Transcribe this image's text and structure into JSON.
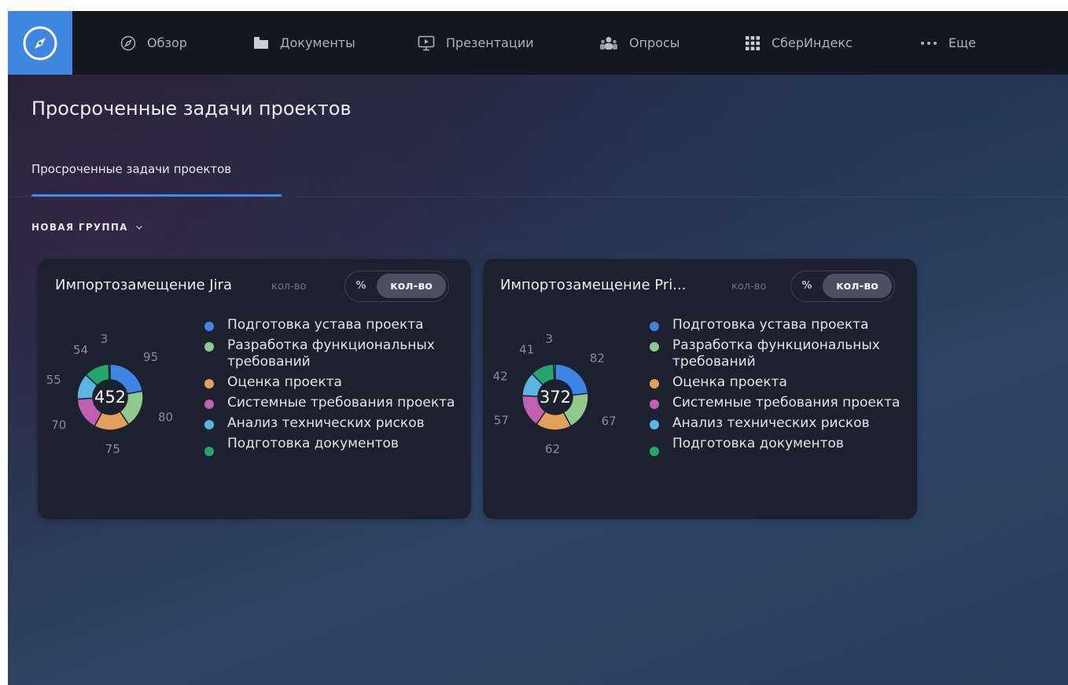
{
  "nav": {
    "items": [
      {
        "label": "Обзор",
        "icon": "compass-icon"
      },
      {
        "label": "Документы",
        "icon": "folder-icon"
      },
      {
        "label": "Презентации",
        "icon": "presentation-play-icon"
      },
      {
        "label": "Опросы",
        "icon": "people-icon"
      },
      {
        "label": "СберИндекс",
        "icon": "grid-icon"
      },
      {
        "label": "Еще",
        "icon": "more-dots-icon"
      }
    ],
    "logo_icon": "compass-logo-icon",
    "logo_color": "#3e86e0"
  },
  "page": {
    "title": "Просроченные задачи проектов",
    "tab_active": "Просроченные задачи проектов",
    "group_label": "НОВАЯ ГРУППА"
  },
  "colors": {
    "accent": "#3a8ef0",
    "series": [
      "#3d86e8",
      "#8fc98c",
      "#e2a05c",
      "#c35fb0",
      "#5ab6e0",
      "#22a66c",
      "#9aa0a8"
    ]
  },
  "cards": [
    {
      "title": "Импортозамещение Jira",
      "unit": "кол-во",
      "toggle": {
        "percent_label": "%",
        "count_label": "кол-во",
        "selected": "кол-во"
      },
      "total": "452",
      "legend": [
        "Подготовка устава проекта",
        "Разработка функциональных требований",
        "Оценка проекта",
        "Системные требования проекта",
        "Анализ технических рисков",
        "Подготовка документов"
      ]
    },
    {
      "title": "Импортозамещение Pri...",
      "unit": "кол-во",
      "toggle": {
        "percent_label": "%",
        "count_label": "кол-во",
        "selected": "кол-во"
      },
      "total": "372",
      "legend": [
        "Подготовка устава проекта",
        "Разработка функциональных требований",
        "Оценка проекта",
        "Системные требования проекта",
        "Анализ технических рисков",
        "Подготовка документов"
      ]
    }
  ],
  "chart_data": [
    {
      "type": "pie",
      "title": "Импортозамещение Jira",
      "categories": [
        "Подготовка устава проекта",
        "Разработка функциональных требований",
        "Оценка проекта",
        "Системные требования проекта",
        "Анализ технических рисков",
        "Подготовка документов",
        ""
      ],
      "values": [
        95,
        80,
        75,
        70,
        55,
        54,
        3
      ],
      "total": 452,
      "donut": true
    },
    {
      "type": "pie",
      "title": "Импортозамещение Pri...",
      "categories": [
        "Подготовка устава проекта",
        "Разработка функциональных требований",
        "Оценка проекта",
        "Системные требования проекта",
        "Анализ технических рисков",
        "Подготовка документов",
        ""
      ],
      "values": [
        82,
        67,
        62,
        57,
        42,
        41,
        3
      ],
      "total": 372,
      "donut": true
    }
  ]
}
